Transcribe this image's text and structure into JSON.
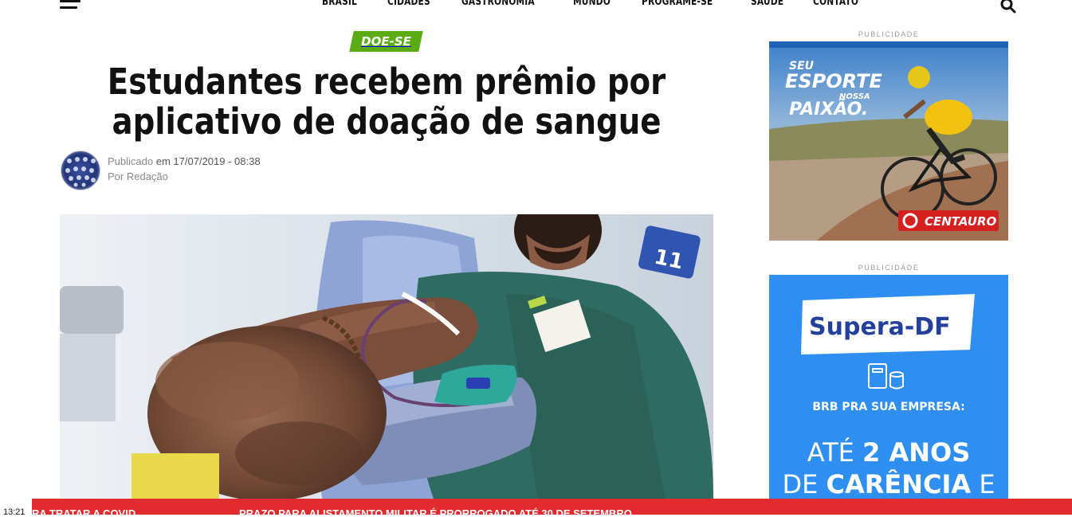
{
  "nav": {
    "items": [
      "BRASIL",
      "CIDADES",
      "GASTRONOMIA",
      "MUNDO",
      "PROGRAME-SE",
      "SAÚDE",
      "CONTATO"
    ]
  },
  "article": {
    "category": "DOE-SE",
    "title": "Estudantes recebem prêmio por aplicativo de doação de sangue",
    "published_prefix": "Publicado",
    "published_date": "em 17/07/2019 - 08:38",
    "author": "Por Redação"
  },
  "sidebar": {
    "pub_label_1": "PUBLICIDADE",
    "pub_label_2": "PUBLICIDADE",
    "ad1": {
      "line1": "SEU",
      "line2": "ESPORTE",
      "line3": "NOSSA",
      "line4": "PAIXÃO.",
      "brand": "CENTAURO"
    },
    "ad2": {
      "brand": "Supera-DF",
      "line1": "BRB PRA SUA EMPRESA:",
      "line2a": "ATÉ ",
      "line2b": "2 ANOS",
      "line3a": "DE ",
      "line3b": "CARÊNCIA",
      "line3c": " E"
    }
  },
  "ticker": {
    "time": "13:21",
    "item1": "RA TRATAR A COVID",
    "item2": "PRAZO PARA ALISTAMENTO MILITAR É PRORROGADO ATÉ 30 DE SETEMBRO"
  },
  "colors": {
    "category_bg": "#5bab14",
    "ticker_bg": "#e12b2f",
    "ad2_bg": "#2f8ff0"
  }
}
